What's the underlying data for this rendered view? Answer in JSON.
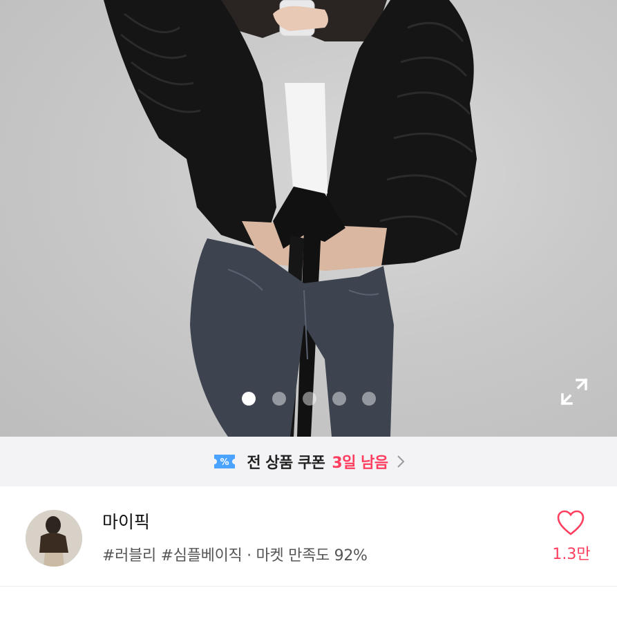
{
  "carousel": {
    "page_count": 5,
    "active_index": 0
  },
  "coupon": {
    "text": "전 상품 쿠폰",
    "days_left": "3일 남음",
    "accent_color": "#ff3d5e",
    "icon": "coupon-ticket-icon"
  },
  "shop": {
    "name": "마이픽",
    "tags": "#러블리 #심플베이직 · 마켓 만족도 92%",
    "likes": "1.3만",
    "like_icon": "heart-outline-icon"
  },
  "icons": {
    "expand": "expand-icon",
    "chevron": "chevron-right-icon"
  }
}
